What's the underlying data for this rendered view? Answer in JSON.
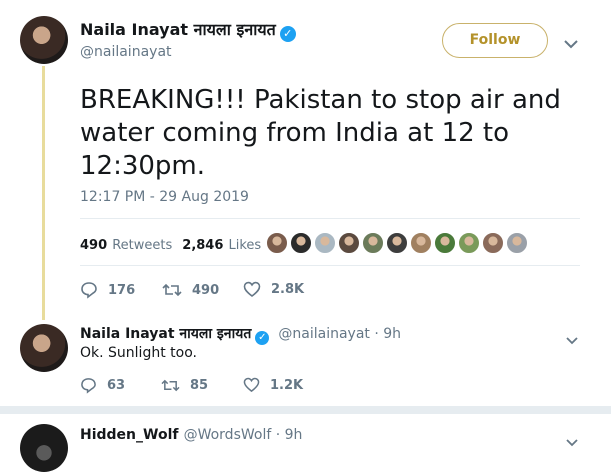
{
  "main_tweet": {
    "display_name": "Naila Inayat नायला इनायत",
    "handle": "@nailainayat",
    "follow_label": "Follow",
    "text_lines": [
      "BREAKING!!! Pakistan to stop air and",
      "water coming from India at 12 to",
      "12:30pm."
    ],
    "timestamp": "12:17 PM - 29 Aug 2019",
    "retweets_count": "490",
    "retweets_label": "Retweets",
    "likes_count": "2,846",
    "likes_label": "Likes",
    "liker_avatar_colors": [
      "#7a5c4c",
      "#2b2b2b",
      "#aab8c2",
      "#5b4a3f",
      "#6b7b5a",
      "#3d3d3d",
      "#a08060",
      "#4a7a3a",
      "#7a9a5a",
      "#8a6a5a",
      "#9aa0a8"
    ],
    "actions": {
      "replies": "176",
      "retweets": "490",
      "likes": "2.8K"
    }
  },
  "reply": {
    "display_name": "Naila Inayat नायला इनायत",
    "handle_time": "@nailainayat · 9h",
    "text": "Ok. Sunlight too.",
    "actions": {
      "replies": "63",
      "retweets": "85",
      "likes": "1.2K"
    }
  },
  "next_tweet": {
    "display_name": "Hidden_Wolf",
    "handle_time": "@WordsWolf · 9h"
  },
  "icons": {
    "verified": "✓",
    "chevron": "⌄",
    "reply": "reply-icon",
    "retweet": "retweet-icon",
    "like": "heart-icon"
  },
  "colors": {
    "verified": "#1da1f2",
    "follow": "#b4922a",
    "thread_line": "#e8dc9c"
  }
}
